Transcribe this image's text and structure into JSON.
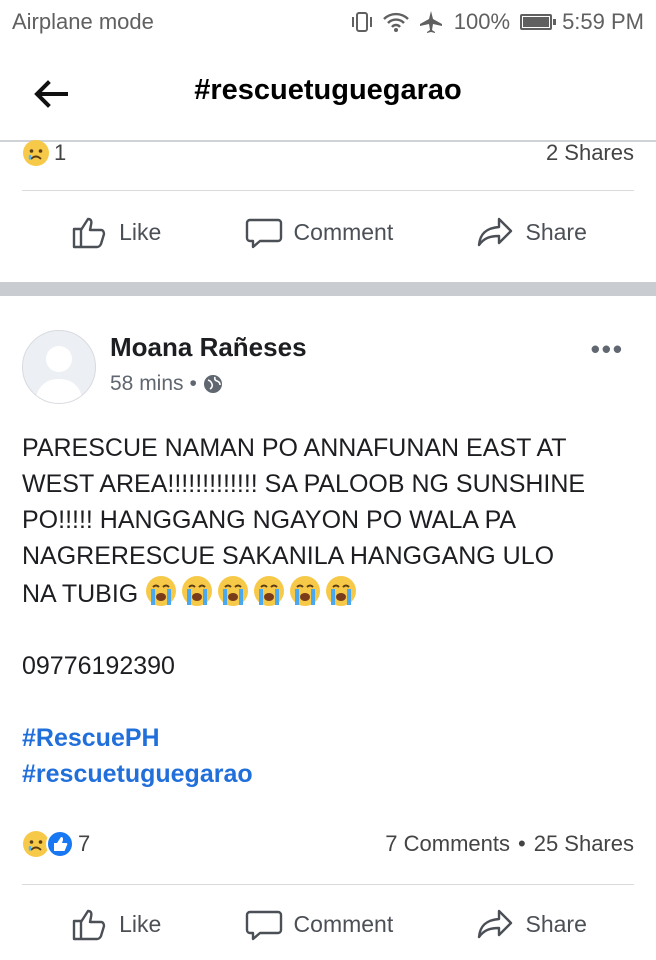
{
  "status_bar": {
    "left_text": "Airplane mode",
    "battery": "100%",
    "time": "5:59 PM"
  },
  "header": {
    "title": "#rescuetuguegarao"
  },
  "previous_post": {
    "reaction_count": "1",
    "shares": "2 Shares",
    "actions": {
      "like": "Like",
      "comment": "Comment",
      "share": "Share"
    }
  },
  "post": {
    "author": "Moana Rañeses",
    "time": "58 mins",
    "separator": "•",
    "more": "•••",
    "body_lines": [
      "PARESCUE NAMAN PO ANNAFUNAN EAST AT",
      "WEST AREA!!!!!!!!!!!!! SA PALOOB NG SUNSHINE",
      "PO!!!!! HANGGANG NGAYON PO WALA PA",
      "NAGRERESCUE SAKANILA HANGGANG ULO",
      "NA TUBIG"
    ],
    "phone": "09776192390",
    "hashtags": [
      "#RescuePH",
      "#rescuetuguegarao"
    ],
    "reaction_count": "7",
    "comments": "7 Comments",
    "stats_separator": "•",
    "shares": "25 Shares",
    "actions": {
      "like": "Like",
      "comment": "Comment",
      "share": "Share"
    }
  },
  "icons": {
    "reaction_sad": "sad-face-icon",
    "reaction_like": "like-thumb-icon",
    "inline_emoji": "loudly-crying-face-icon"
  },
  "colors": {
    "link": "#216fdb",
    "divider_band": "#c9ccd1"
  }
}
